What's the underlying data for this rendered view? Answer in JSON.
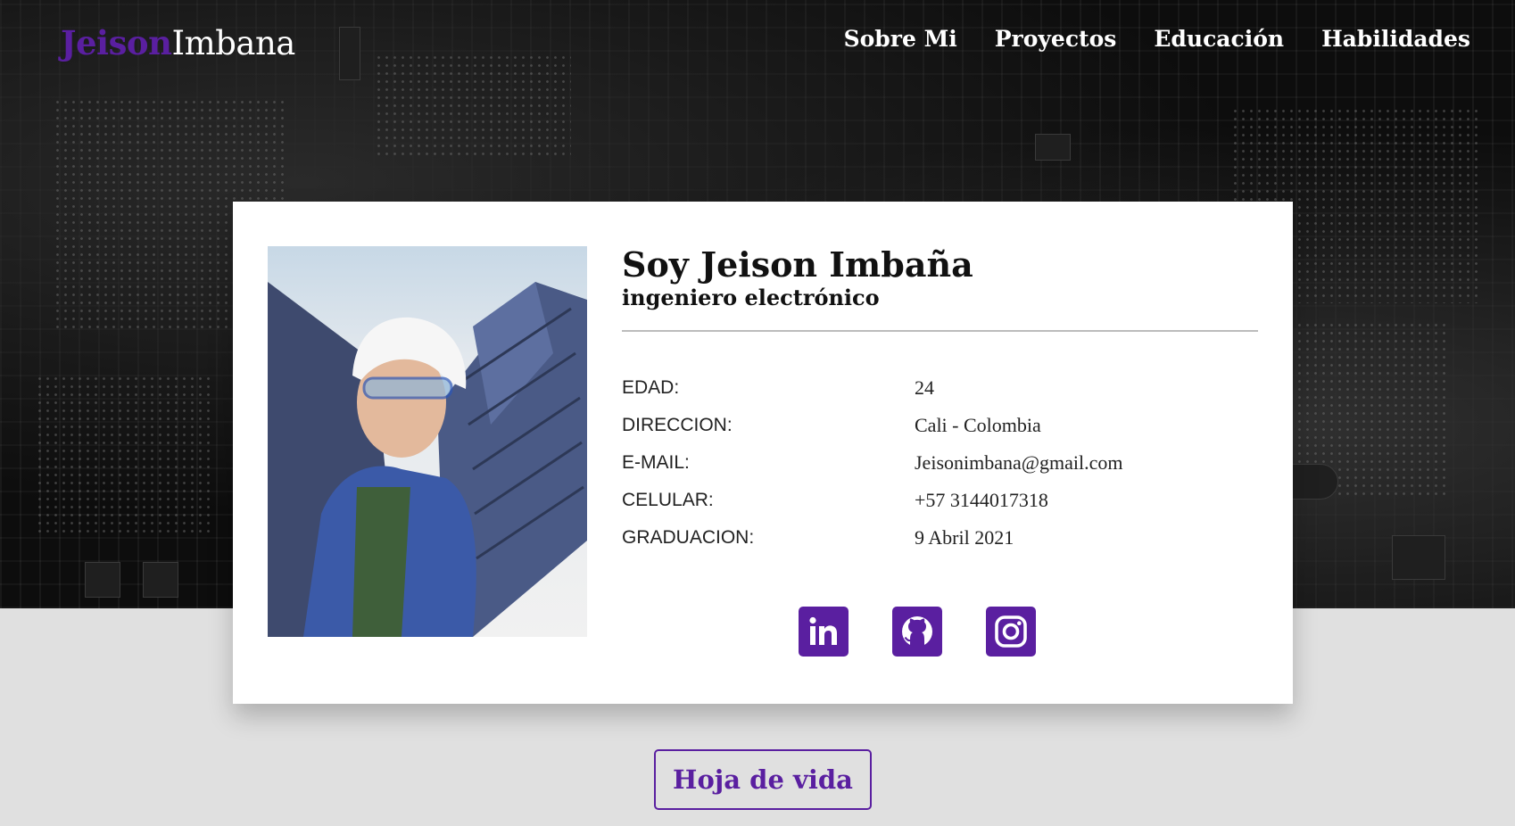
{
  "brand": {
    "first": "Jeison",
    "last": "Imbana"
  },
  "nav": {
    "items": [
      "Sobre Mi",
      "Proyectos",
      "Educación",
      "Habilidades"
    ]
  },
  "profile": {
    "name": "Soy Jeison Imbaña",
    "role": "ingeniero electrónico",
    "fields": [
      {
        "label": "EDAD:",
        "value": "24"
      },
      {
        "label": "DIRECCION:",
        "value": "Cali - Colombia"
      },
      {
        "label": "E-MAIL:",
        "value": "Jeisonimbana@gmail.com"
      },
      {
        "label": "CELULAR:",
        "value": "+57 3144017318"
      },
      {
        "label": "GRADUACION:",
        "value": "9 Abril 2021"
      }
    ],
    "social_icons": [
      "linkedin-icon",
      "github-icon",
      "instagram-icon"
    ]
  },
  "cv_button": {
    "label": "Hoja de vida"
  },
  "colors": {
    "accent": "#5a1fa0",
    "hero_bg": "#0d0d0d",
    "page_bg": "#e0e0e0",
    "card_bg": "#ffffff"
  }
}
